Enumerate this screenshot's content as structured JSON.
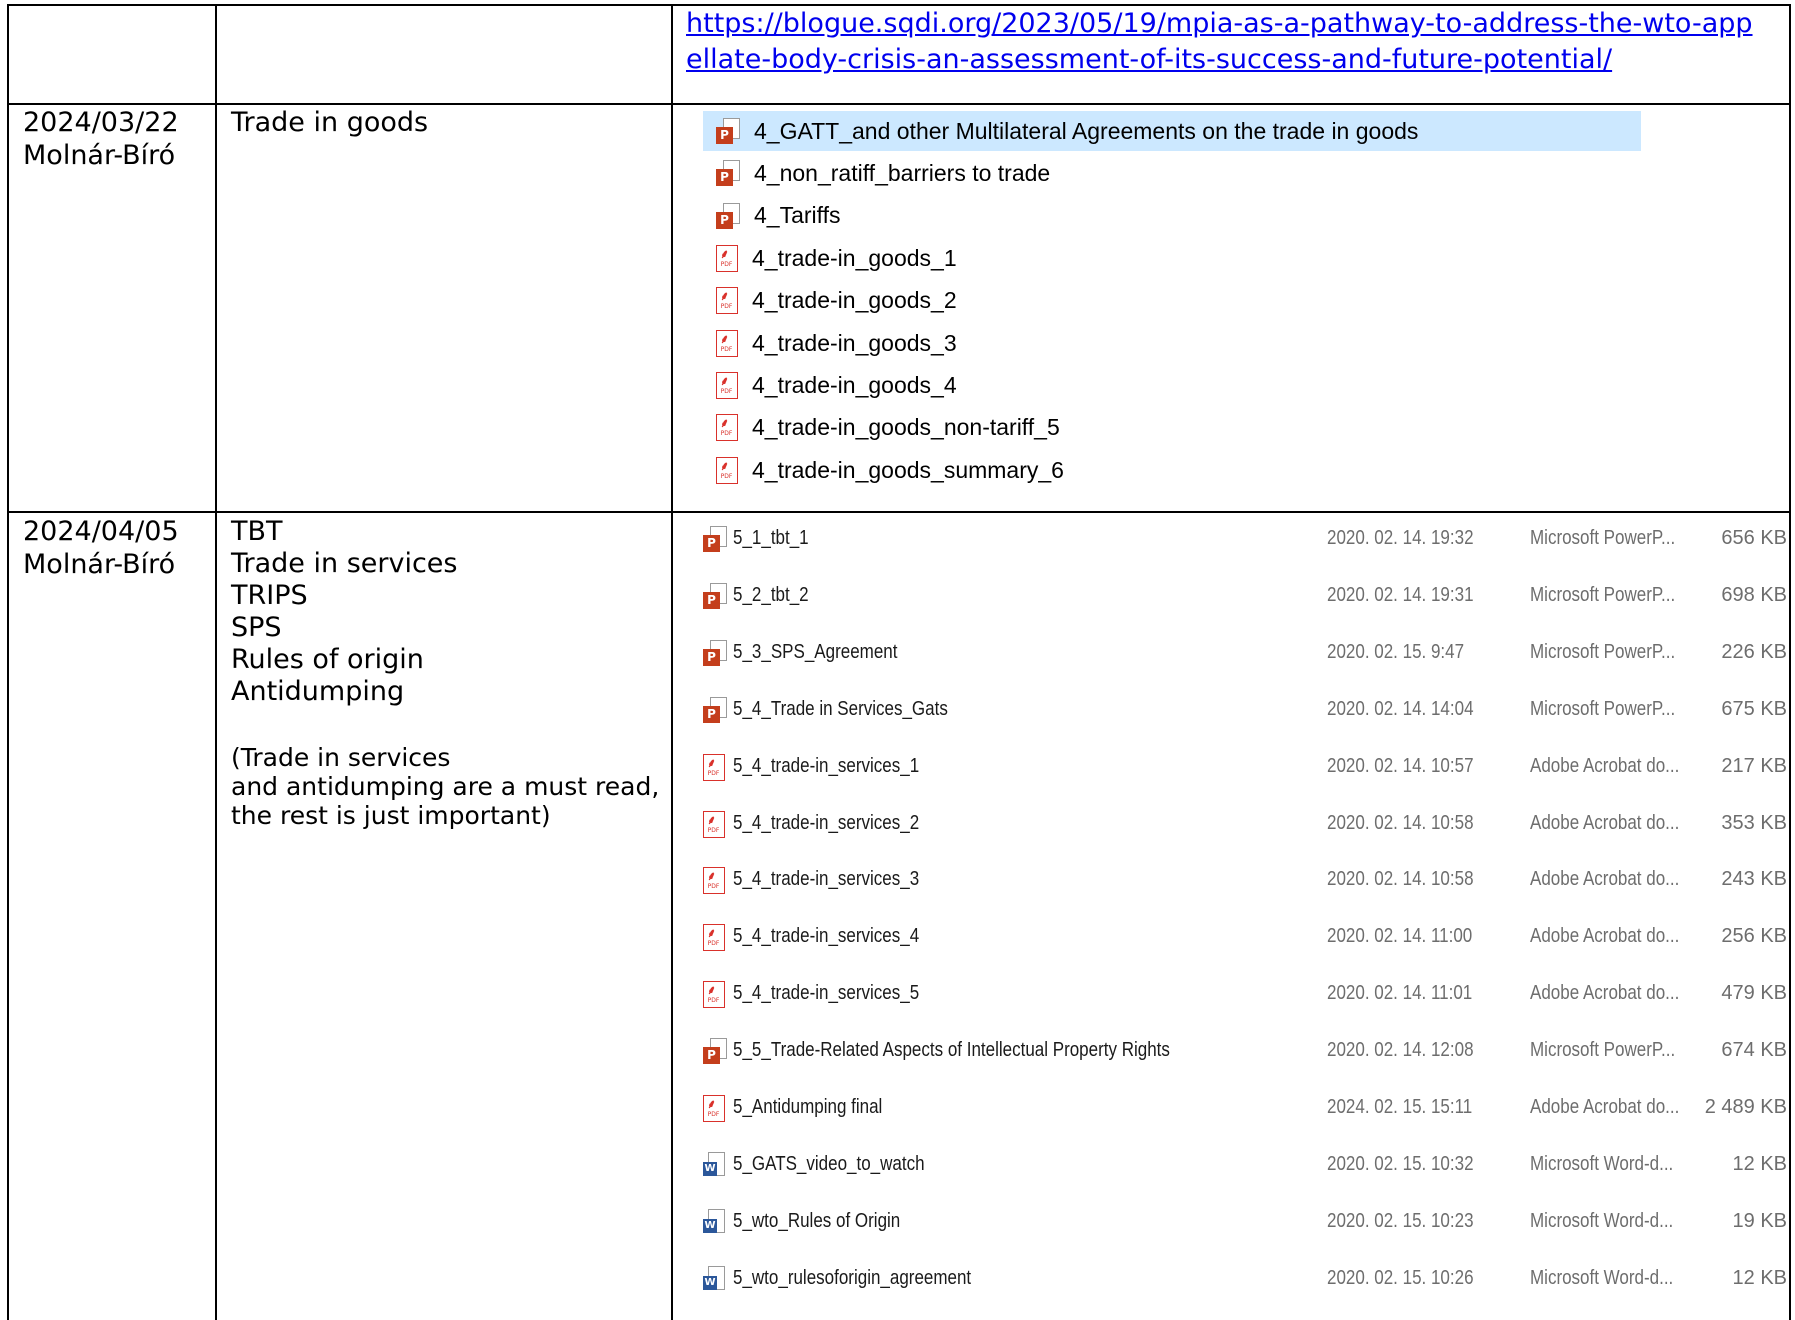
{
  "row0": {
    "link": "https://blogue.sqdi.org/2023/05/19/mpia-as-a-pathway-to-address-the-wto-appellate-body-crisis-an-assessment-of-its-success-and-future-potential/"
  },
  "row1": {
    "date": "2024/03/22",
    "lecturer": "Molnár-Bíró",
    "topic": "Trade in goods",
    "files": [
      {
        "icon": "powerpoint-icon",
        "name": "4_GATT_and other Multilateral Agreements on the trade in goods",
        "selected": true
      },
      {
        "icon": "powerpoint-icon",
        "name": "4_non_ratiff_barriers to trade"
      },
      {
        "icon": "powerpoint-icon",
        "name": "4_Tariffs"
      },
      {
        "icon": "pdf-icon",
        "name": "4_trade-in_goods_1"
      },
      {
        "icon": "pdf-icon",
        "name": "4_trade-in_goods_2"
      },
      {
        "icon": "pdf-icon",
        "name": "4_trade-in_goods_3"
      },
      {
        "icon": "pdf-icon",
        "name": "4_trade-in_goods_4"
      },
      {
        "icon": "pdf-icon",
        "name": "4_trade-in_goods_non-tariff_5"
      },
      {
        "icon": "pdf-icon",
        "name": "4_trade-in_goods_summary_6"
      }
    ]
  },
  "row2": {
    "date": "2024/04/05",
    "lecturer": "Molnár-Bíró",
    "topics": [
      "TBT",
      "Trade in services",
      "TRIPS",
      "SPS",
      "Rules of origin",
      "Antidumping"
    ],
    "note_lines": [
      "(Trade in services",
      "and antidumping are a must read,",
      "the rest is just important)"
    ],
    "files": [
      {
        "icon": "powerpoint-icon",
        "name": "5_1_tbt_1",
        "date": "2020. 02. 14. 19:32",
        "type": "Microsoft PowerP...",
        "size": "656 KB"
      },
      {
        "icon": "powerpoint-icon",
        "name": "5_2_tbt_2",
        "date": "2020. 02. 14. 19:31",
        "type": "Microsoft PowerP...",
        "size": "698 KB"
      },
      {
        "icon": "powerpoint-icon",
        "name": "5_3_SPS_Agreement",
        "date": "2020. 02. 15. 9:47",
        "type": "Microsoft PowerP...",
        "size": "226 KB"
      },
      {
        "icon": "powerpoint-icon",
        "name": "5_4_Trade in Services_Gats",
        "date": "2020. 02. 14. 14:04",
        "type": "Microsoft PowerP...",
        "size": "675 KB"
      },
      {
        "icon": "pdf-icon",
        "name": "5_4_trade-in_services_1",
        "date": "2020. 02. 14. 10:57",
        "type": "Adobe Acrobat do...",
        "size": "217 KB"
      },
      {
        "icon": "pdf-icon",
        "name": "5_4_trade-in_services_2",
        "date": "2020. 02. 14. 10:58",
        "type": "Adobe Acrobat do...",
        "size": "353 KB"
      },
      {
        "icon": "pdf-icon",
        "name": "5_4_trade-in_services_3",
        "date": "2020. 02. 14. 10:58",
        "type": "Adobe Acrobat do...",
        "size": "243 KB"
      },
      {
        "icon": "pdf-icon",
        "name": "5_4_trade-in_services_4",
        "date": "2020. 02. 14. 11:00",
        "type": "Adobe Acrobat do...",
        "size": "256 KB"
      },
      {
        "icon": "pdf-icon",
        "name": "5_4_trade-in_services_5",
        "date": "2020. 02. 14. 11:01",
        "type": "Adobe Acrobat do...",
        "size": "479 KB"
      },
      {
        "icon": "powerpoint-icon",
        "name": "5_5_Trade-Related Aspects of Intellectual Property Rights",
        "date": "2020. 02. 14. 12:08",
        "type": "Microsoft PowerP...",
        "size": "674 KB"
      },
      {
        "icon": "pdf-icon",
        "name": "5_Antidumping final",
        "date": "2024. 02. 15. 15:11",
        "type": "Adobe Acrobat do...",
        "size": "2 489 KB"
      },
      {
        "icon": "word-icon",
        "name": "5_GATS_video_to_watch",
        "date": "2020. 02. 15. 10:32",
        "type": "Microsoft Word-d...",
        "size": "12 KB"
      },
      {
        "icon": "word-icon",
        "name": "5_wto_Rules of Origin",
        "date": "2020. 02. 15. 10:23",
        "type": "Microsoft Word-d...",
        "size": "19 KB"
      },
      {
        "icon": "word-icon",
        "name": "5_wto_rulesoforigin_agreement",
        "date": "2020. 02. 15. 10:26",
        "type": "Microsoft Word-d...",
        "size": "12 KB"
      }
    ]
  }
}
